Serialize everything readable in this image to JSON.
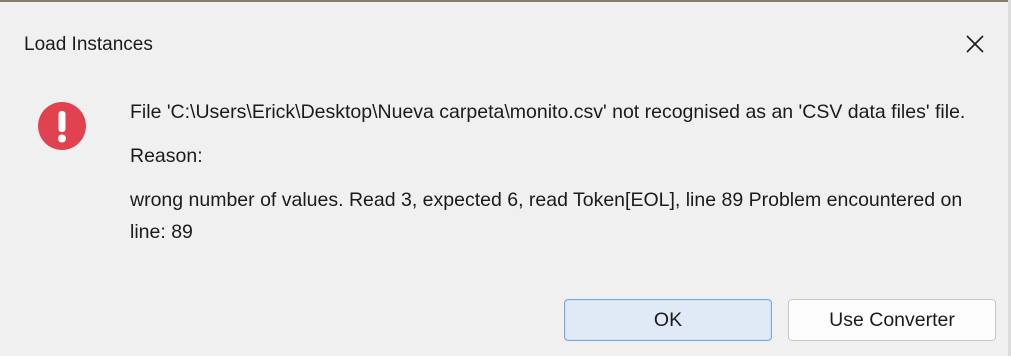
{
  "dialog": {
    "title": "Load Instances",
    "close_icon": "close-icon",
    "icon": "error-icon",
    "message_line1": "File 'C:\\Users\\Erick\\Desktop\\Nueva carpeta\\monito.csv' not recognised as an 'CSV data files' file.",
    "reason_label": "Reason:",
    "reason_text": "wrong number of values. Read 3, expected 6, read Token[EOL], line 89 Problem encountered on line: 89",
    "buttons": {
      "ok_label": "OK",
      "converter_label": "Use Converter"
    },
    "colors": {
      "error_red": "#e0434f",
      "ok_background": "#e0eaf6",
      "ok_border": "#7aa7da"
    }
  }
}
